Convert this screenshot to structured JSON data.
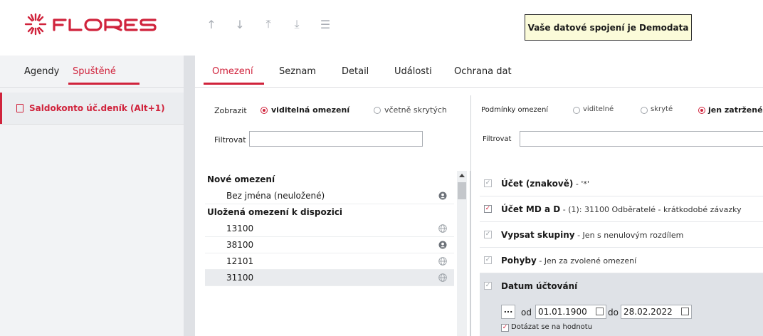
{
  "app": {
    "brand": "FLORES"
  },
  "header": {
    "nav_icons": [
      "arrow-up-icon",
      "arrow-down-icon",
      "arrow-to-top-icon",
      "arrow-to-bottom-icon",
      "menu-icon"
    ],
    "connection_message": "Vaše datové spojení je Demodata"
  },
  "left": {
    "tabs": [
      {
        "label": "Agendy",
        "active": false
      },
      {
        "label": "Spuštěné",
        "active": true
      }
    ],
    "items": [
      {
        "label": "Saldokonto úč.deník (Alt+1)",
        "active": true
      }
    ]
  },
  "main": {
    "tabs": [
      {
        "label": "Omezení",
        "active": true
      },
      {
        "label": "Seznam",
        "active": false
      },
      {
        "label": "Detail",
        "active": false
      },
      {
        "label": "Události",
        "active": false
      },
      {
        "label": "Ochrana dat",
        "active": false
      }
    ]
  },
  "left_panel": {
    "show_label": "Zobrazit",
    "show_options": [
      {
        "label": "viditelná omezení",
        "selected": true
      },
      {
        "label": "včetně skrytých",
        "selected": false
      }
    ],
    "filter_label": "Filtrovat",
    "filter_value": "",
    "new_header": "Nové omezení",
    "new_items": [
      {
        "label": "Bez jména (neuložené)",
        "icon": "user-icon"
      }
    ],
    "saved_header": "Uložená omezení k dispozici",
    "saved_items": [
      {
        "label": "13100",
        "icon": "globe-icon"
      },
      {
        "label": "38100",
        "icon": "user-icon"
      },
      {
        "label": "12101",
        "icon": "globe-icon"
      },
      {
        "label": "31100",
        "icon": "globe-icon",
        "highlighted": true
      }
    ]
  },
  "right_panel": {
    "conditions_label": "Podmínky omezení",
    "condition_options": [
      {
        "label": "viditelné",
        "selected": false
      },
      {
        "label": "skryté",
        "selected": false
      },
      {
        "label": "jen zatržené",
        "selected": true
      }
    ],
    "filter_label": "Filtrovat",
    "filter_value": "",
    "conditions": [
      {
        "title": "Účet (znakově)",
        "desc": " - '*'",
        "checked": false
      },
      {
        "title": "Účet MD a D",
        "desc": " - (1): 31100 Odběratelé - krátkodobé závazky",
        "checked": true
      },
      {
        "title": "Vypsat skupiny",
        "desc": " - Jen s nenulovým rozdílem",
        "checked": false
      },
      {
        "title": "Pohyby",
        "desc": " - Jen za zvolené omezení",
        "checked": false
      }
    ],
    "date_condition": {
      "title": "Datum účtování",
      "checked": false,
      "dots_label": "...",
      "from_label": "od",
      "from_value": "01.01.1900",
      "to_label": "do",
      "to_value": "28.02.2022",
      "ask_label": "Dotázat se na hodnotu",
      "ask_checked": true
    }
  },
  "colors": {
    "accent": "#d0233c",
    "notice_bg": "#fbfbd9"
  }
}
